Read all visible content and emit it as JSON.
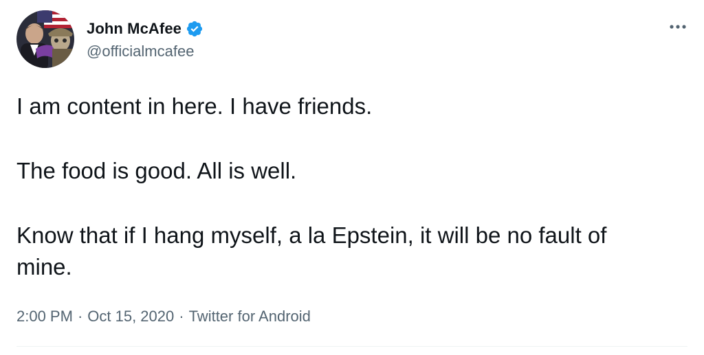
{
  "user": {
    "display_name": "John McAfee",
    "handle": "@officialmcafee",
    "verified": true,
    "avatar_icon": "profile-photo",
    "verified_icon": "verified-badge-icon",
    "verified_color": "#1d9bf0"
  },
  "more_icon": "more-horizontal-icon",
  "tweet": {
    "paragraphs": [
      "I am content in here. I have friends.",
      "The food is good. All is well.",
      "Know that if I hang myself, a la Epstein, it will be no fault of mine."
    ]
  },
  "meta": {
    "time": "2:00 PM",
    "separator": "·",
    "date": "Oct 15, 2020",
    "source": "Twitter for Android"
  },
  "colors": {
    "text": "#0f1419",
    "secondary": "#536471",
    "divider": "#eff3f4"
  }
}
